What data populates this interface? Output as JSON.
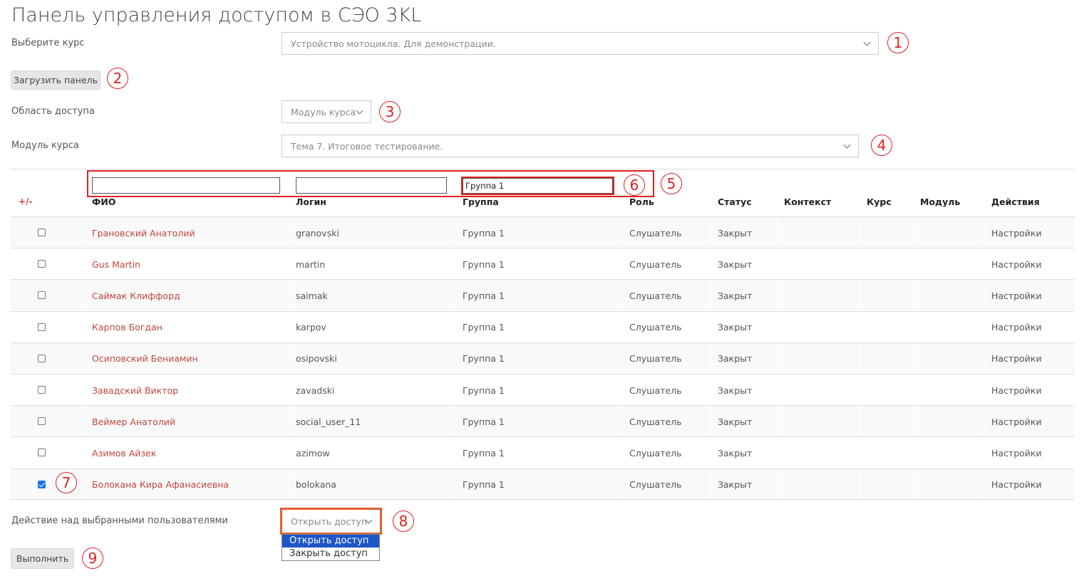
{
  "page": {
    "title": "Панель управления доступом в СЭО 3KL"
  },
  "course": {
    "label": "Выберите курс",
    "value": "Устройство мотоцикла. Для демонстрации."
  },
  "load_button": "Загрузить панель",
  "scope": {
    "label": "Область доступа",
    "value": "Модуль курса"
  },
  "module": {
    "label": "Модуль курса",
    "value": "Тема 7. Итоговое тестирование."
  },
  "filters": {
    "fio": "",
    "login": "",
    "group": "Группа 1"
  },
  "table": {
    "toggle": "+/-",
    "headers": [
      "ФИО",
      "Логин",
      "Группа",
      "Роль",
      "Статус",
      "Контекст",
      "Курс",
      "Модуль",
      "Действия"
    ],
    "rows": [
      {
        "checked": false,
        "name": "Грановский Анатолий",
        "login": "granovski",
        "group": "Группа 1",
        "role": "Слушатель",
        "status": "Закрыт",
        "context": "",
        "course": "",
        "module": "",
        "action": "Настройки"
      },
      {
        "checked": false,
        "name": "Gus Martin",
        "login": "martin",
        "group": "Группа 1",
        "role": "Слушатель",
        "status": "Закрыт",
        "context": "",
        "course": "",
        "module": "",
        "action": "Настройки"
      },
      {
        "checked": false,
        "name": "Саймак Клиффорд",
        "login": "saimak",
        "group": "Группа 1",
        "role": "Слушатель",
        "status": "Закрыт",
        "context": "",
        "course": "",
        "module": "",
        "action": "Настройки"
      },
      {
        "checked": false,
        "name": "Карпов Богдан",
        "login": "karpov",
        "group": "Группа 1",
        "role": "Слушатель",
        "status": "Закрыт",
        "context": "",
        "course": "",
        "module": "",
        "action": "Настройки"
      },
      {
        "checked": false,
        "name": "Осиповский Бениамин",
        "login": "osipovski",
        "group": "Группа 1",
        "role": "Слушатель",
        "status": "Закрыт",
        "context": "",
        "course": "",
        "module": "",
        "action": "Настройки"
      },
      {
        "checked": false,
        "name": "Завадский Виктор",
        "login": "zavadski",
        "group": "Группа 1",
        "role": "Слушатель",
        "status": "Закрыт",
        "context": "",
        "course": "",
        "module": "",
        "action": "Настройки"
      },
      {
        "checked": false,
        "name": "Веймер Анатолий",
        "login": "social_user_11",
        "group": "Группа 1",
        "role": "Слушатель",
        "status": "Закрыт",
        "context": "",
        "course": "",
        "module": "",
        "action": "Настройки"
      },
      {
        "checked": false,
        "name": "Азимов Айзек",
        "login": "azimow",
        "group": "Группа 1",
        "role": "Слушатель",
        "status": "Закрыт",
        "context": "",
        "course": "",
        "module": "",
        "action": "Настройки"
      },
      {
        "checked": true,
        "name": "Болокана Кира Афанасиевна",
        "login": "bolokana",
        "group": "Группа 1",
        "role": "Слушатель",
        "status": "Закрыт",
        "context": "",
        "course": "",
        "module": "",
        "action": "Настройки"
      }
    ]
  },
  "bulk": {
    "label": "Действие над выбранными пользователями",
    "value": "Открыть доступ",
    "options": [
      "Открыть доступ",
      "Закрыть доступ"
    ],
    "execute": "Выполнить"
  },
  "annotations": [
    "1",
    "2",
    "3",
    "4",
    "5",
    "6",
    "7",
    "8",
    "9"
  ],
  "colors": {
    "annotation": "#e02020",
    "link": "#c0463e",
    "highlight_border": "#e06030",
    "option_selected": "#1e56c8"
  }
}
